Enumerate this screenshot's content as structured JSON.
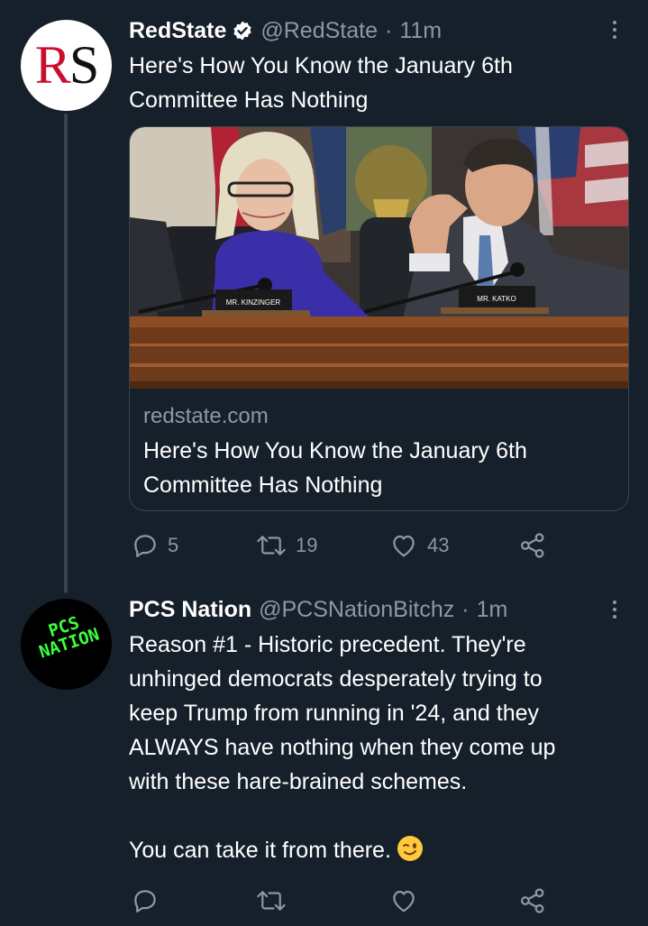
{
  "tweets": [
    {
      "avatar_letters": {
        "first": "R",
        "second": "S"
      },
      "name": "RedState",
      "handle": "@RedState",
      "time": "11m",
      "text_lines": [
        "Here's How You Know the January 6th",
        "Committee Has Nothing"
      ],
      "card": {
        "domain": "redstate.com",
        "title_lines": [
          "Here's How You Know the January 6th",
          "Committee Has Nothing"
        ],
        "nameplate_left": "MR. KINZINGER",
        "nameplate_right": "MR. KATKO"
      },
      "replies": "5",
      "retweets": "19",
      "likes": "43"
    },
    {
      "avatar_text": [
        "PCS",
        "NATION"
      ],
      "name": "PCS Nation",
      "handle": "@PCSNationBitchz",
      "time": "1m",
      "text_lines": [
        "Reason #1 - Historic precedent. They're",
        "unhinged democrats desperately trying to",
        "keep Trump from running in '24, and they",
        "ALWAYS have nothing when they come up",
        "with these hare-brained schemes.",
        "",
        "You can take it from there."
      ]
    }
  ],
  "icons": {
    "verified": "verified-badge-icon",
    "more": "more-options-icon",
    "reply": "reply-icon",
    "retweet": "retweet-icon",
    "like": "like-icon",
    "share": "share-icon",
    "emoji": "winking-face-emoji"
  },
  "colors": {
    "background": "#15202b",
    "secondary_text": "#8b98a5",
    "border": "#38444d"
  }
}
